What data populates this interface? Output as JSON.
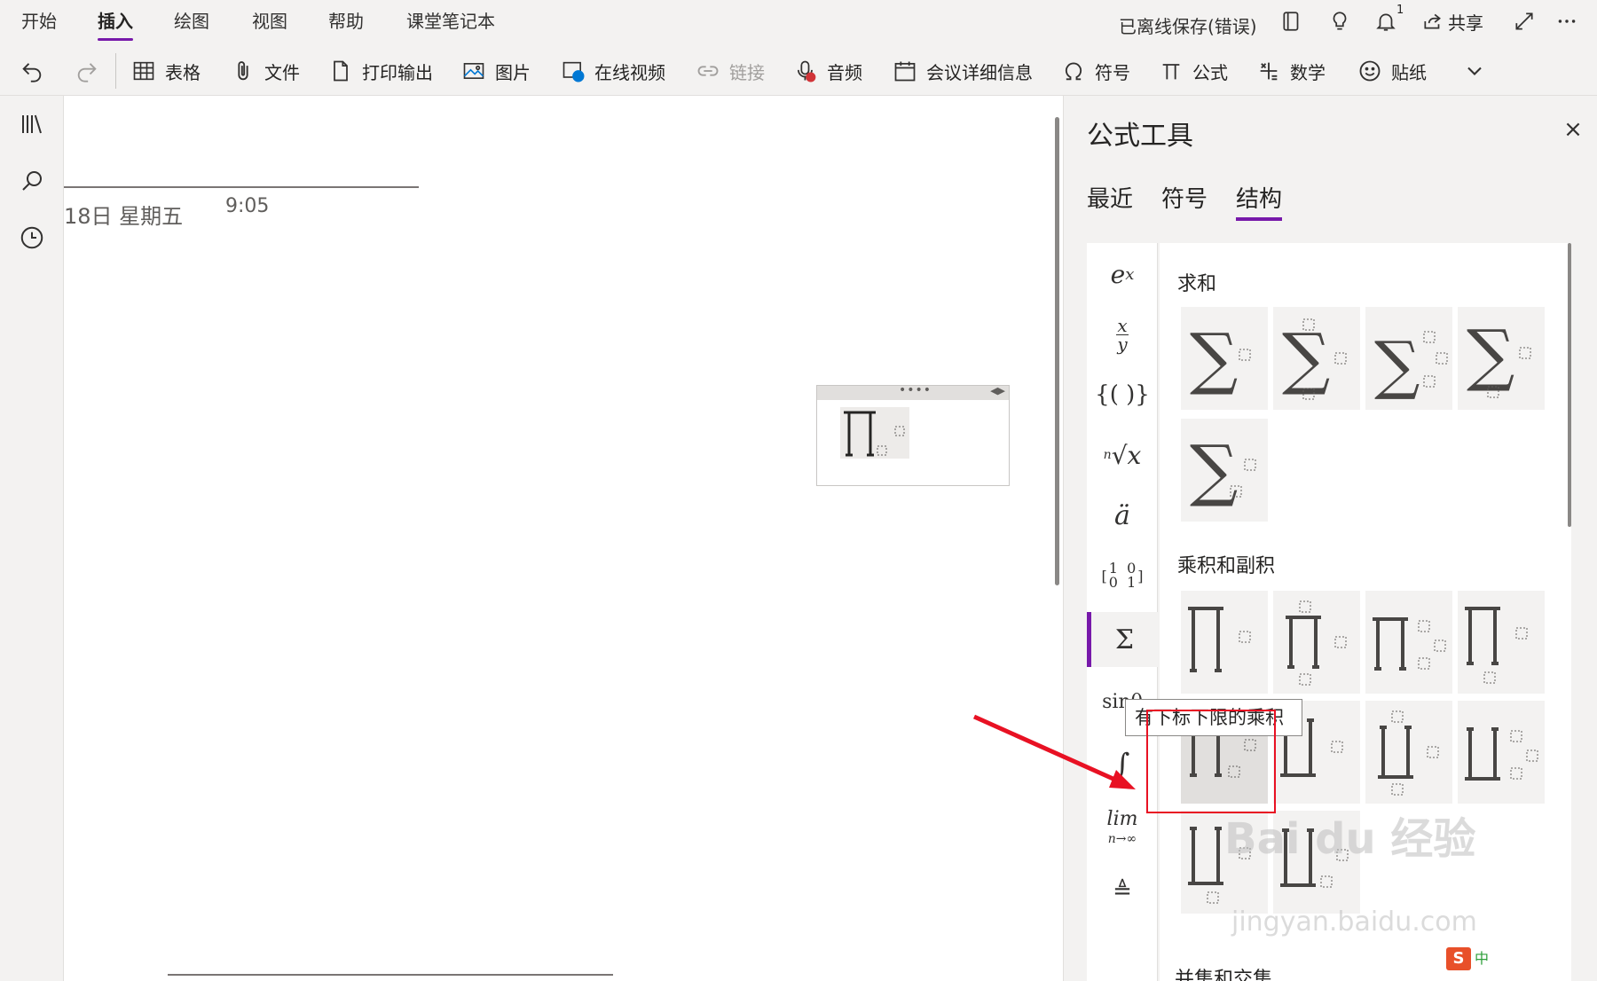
{
  "ribbon": {
    "tabs": [
      "开始",
      "插入",
      "绘图",
      "视图",
      "帮助",
      "课堂笔记本"
    ],
    "active_tab": "插入",
    "status": "已离线保存(错误)",
    "notification_count": "1",
    "share_label": "共享"
  },
  "toolbar": {
    "table": "表格",
    "file": "文件",
    "printout": "打印输出",
    "picture": "图片",
    "online_video": "在线视频",
    "link": "链接",
    "audio": "音频",
    "meeting": "会议详细信息",
    "symbol": "符号",
    "equation": "公式",
    "math": "数学",
    "sticker": "贴纸"
  },
  "page": {
    "date": "18日 星期五",
    "time": "9:05"
  },
  "panel": {
    "title": "公式工具",
    "close": "×",
    "tabs": [
      "最近",
      "符号",
      "结构"
    ],
    "active_tab": "结构",
    "categories": [
      "script",
      "fraction",
      "bracket",
      "radical",
      "accent",
      "matrix",
      "large-operator",
      "function",
      "integral",
      "limit",
      "operator"
    ],
    "sections": {
      "sum": "求和",
      "product": "乘积和副积",
      "set": "并集和交集"
    },
    "tooltip": "有下标下限的乘积"
  },
  "accent_color": "#7719aa",
  "highlight_color": "#e81123",
  "watermark": {
    "main": "Bai du 经验",
    "sub": "jingyan.baidu.com"
  },
  "ime": {
    "logo": "S",
    "mode": "中"
  }
}
